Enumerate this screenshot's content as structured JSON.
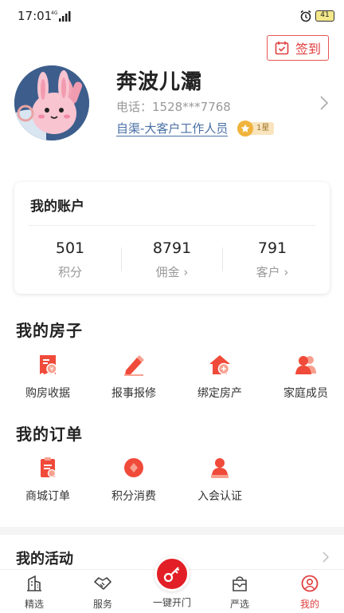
{
  "status_bar": {
    "time": "17:01",
    "network": "4G",
    "battery": "41"
  },
  "header": {
    "signin_label": "签到"
  },
  "profile": {
    "name": "奔波儿灞",
    "phone": "电话：1528***7768",
    "role": "自渠-大客户工作人员",
    "level": "1星"
  },
  "account": {
    "title": "我的账户",
    "stats": [
      {
        "value": "501",
        "label": "积分"
      },
      {
        "value": "8791",
        "label": "佣金 ›"
      },
      {
        "value": "791",
        "label": "客户 ›"
      }
    ]
  },
  "house": {
    "title": "我的房子",
    "items": [
      {
        "label": "购房收据",
        "icon": "receipt-icon"
      },
      {
        "label": "报事报修",
        "icon": "edit-pencil-icon"
      },
      {
        "label": "绑定房产",
        "icon": "home-link-icon"
      },
      {
        "label": "家庭成员",
        "icon": "family-members-icon"
      }
    ]
  },
  "orders": {
    "title": "我的订单",
    "items": [
      {
        "label": "商城订单",
        "icon": "clipboard-order-icon"
      },
      {
        "label": "积分消费",
        "icon": "points-coin-icon"
      },
      {
        "label": "入会认证",
        "icon": "member-certify-icon"
      }
    ]
  },
  "activity": {
    "title": "我的活动"
  },
  "tabs": [
    {
      "label": "精选",
      "icon": "building-icon"
    },
    {
      "label": "服务",
      "icon": "handshake-icon"
    },
    {
      "label": "一键开门",
      "icon": "key-icon"
    },
    {
      "label": "严选",
      "icon": "shopping-box-icon"
    },
    {
      "label": "我的",
      "icon": "user-circle-icon"
    }
  ],
  "colors": {
    "accent": "#e21f26",
    "link": "#4a6fa5",
    "icon_red": "#f04a3a"
  }
}
